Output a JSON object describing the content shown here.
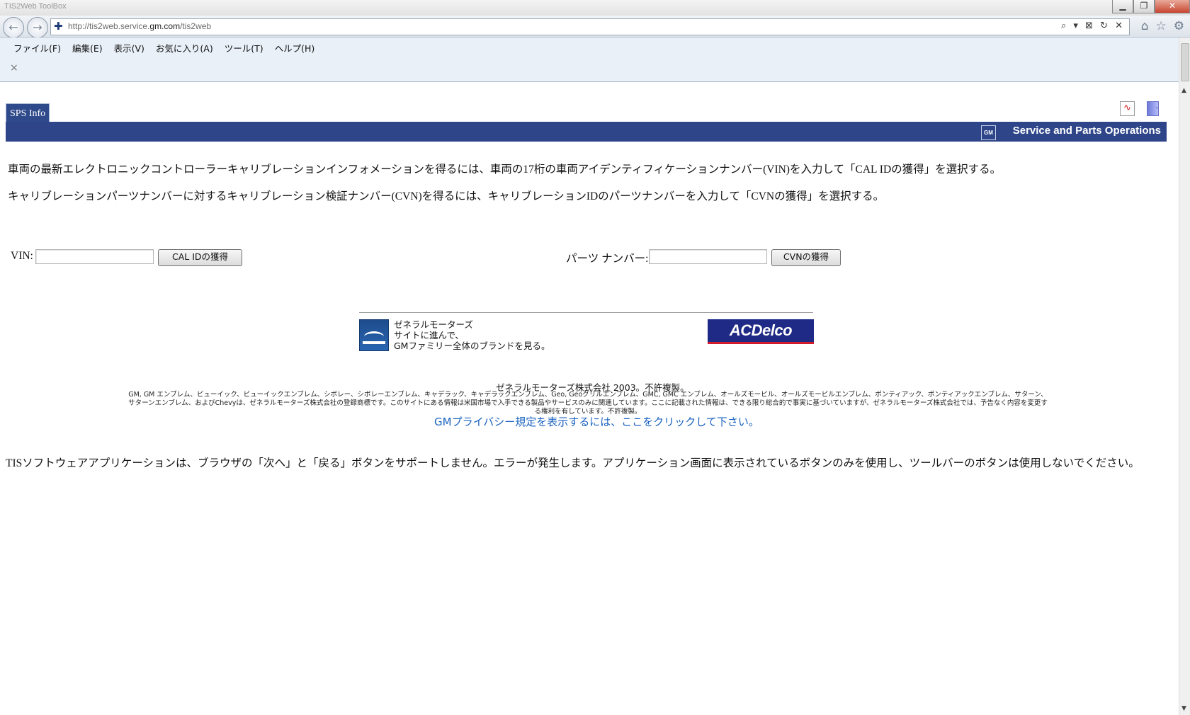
{
  "browser": {
    "title": "TIS2Web ToolBox",
    "url_prefix": "http://tis2web.service.",
    "url_domain": "gm.com",
    "url_suffix": "/tis2web",
    "back_icon": "back-arrow-icon",
    "forward_icon": "forward-arrow-icon",
    "tool_icons": "⌕ ▾ ⊠ ↻ ✕",
    "right_icons": [
      "home-icon",
      "star-icon",
      "gear-icon"
    ]
  },
  "window_buttons": {
    "minimize": "▁",
    "restore": "❐",
    "close": "✕"
  },
  "menu": {
    "items": [
      "ファイル(F)",
      "編集(E)",
      "表示(V)",
      "お気に入り(A)",
      "ツール(T)",
      "ヘルプ(H)"
    ],
    "close_x": "×"
  },
  "page": {
    "tab_label": "SPS Info",
    "gm_logo": "GM",
    "header_title": "Service and Parts Operations",
    "instruction1": "車両の最新エレクトロニックコントローラーキャリブレーションインフォメーションを得るには、車両の17桁の車両アイデンティフィケーションナンバー(VIN)を入力して「CAL IDの獲得」を選択する。",
    "instruction2": "キャリブレーションパーツナンバーに対するキャリブレーション検証ナンバー(CVN)を得るには、キャリブレーションIDのパーツナンバーを入力して「CVNの獲得」を選択する。",
    "vin_label": "VIN:",
    "vin_value": "",
    "cal_button": "CAL IDの獲得",
    "part_label": "パーツ ナンバー:",
    "part_value": "",
    "cvn_button": "CVNの獲得",
    "brand_line1": "ゼネラルモーターズ",
    "brand_line2": "サイトに進んで、",
    "brand_line3": "GMファミリー全体のブランドを見る。",
    "acdelco_a": "AC",
    "acdelco_b": "Delco",
    "copyright": "ゼネラルモーターズ株式会社 2003。不許複製。",
    "legal": "GM, GM エンブレム、ビューイック、ビューイックエンブレム、シボレー、シボレーエンブレム、キャデラック、キャデラックエンブレム、Geo, Geoグリルエンブレム、GMC, GMC エンブレム、オールズモービル、オールズモービルエンブレム、ポンティアック、ポンティアックエンブレム、サターン、サターンエンブレム、およびChevyは、ゼネラルモーターズ株式会社の登録商標です。このサイトにある情報は米国市場で入手できる製品やサービスのみに関連しています。ここに記載された情報は、できる限り総合的で事実に基づいていますが、ゼネラルモーターズ株式会社では、予告なく内容を変更する権利を有しています。不許複製。",
    "privacy_link": "GMプライバシー規定を表示するには、ここをクリックして下さい。",
    "warning": "TISソフトウェアアプリケーションは、ブラウザの「次へ」と「戻る」ボタンをサポートしません。エラーが発生します。アプリケーション画面に表示されているボタンのみを使用し、ツールバーのボタンは使用しないでください。"
  },
  "colors": {
    "header_blue": "#2e4589",
    "link_blue": "#1a62c0",
    "acdelco_red": "#d21b2a"
  }
}
